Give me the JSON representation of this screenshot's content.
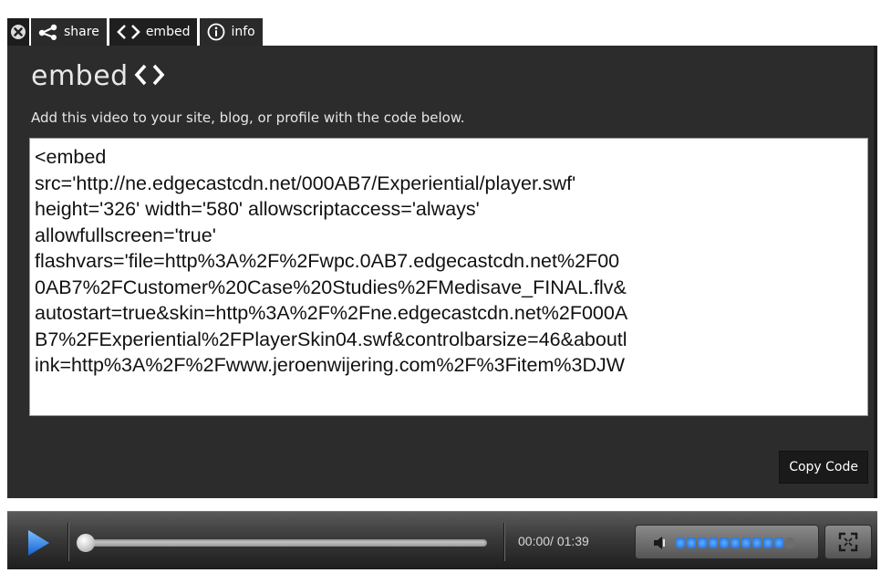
{
  "tabs": [
    {
      "label": "share",
      "icon": "share-icon"
    },
    {
      "label": "embed",
      "icon": "code-brackets-icon"
    },
    {
      "label": "info",
      "icon": "info-icon"
    }
  ],
  "panel": {
    "title": "embed",
    "subtitle": "Add this video to your site, blog, or profile with the code below.",
    "code_lines": [
      "<embed",
      "src='http://ne.edgecastcdn.net/000AB7/Experiential/player.swf'",
      "height='326' width='580' allowscriptaccess='always'",
      "allowfullscreen='true'",
      "flashvars='file=http%3A%2F%2Fwpc.0AB7.edgecastcdn.net%2F00",
      "0AB7%2FCustomer%20Case%20Studies%2FMedisave_FINAL.flv&",
      "autostart=true&skin=http%3A%2F%2Fne.edgecastcdn.net%2F000A",
      "B7%2FExperiential%2FPlayerSkin04.swf&controlbarsize=46&aboutl",
      "ink=http%3A%2F%2Fwww.jeroenwijering.com%2F%3Fitem%3DJW"
    ],
    "copy_button": "Copy Code"
  },
  "controls": {
    "time": "00:00/ 01:39",
    "progress": 0.0,
    "volume_segments_on": 10,
    "volume_segments_total": 11
  },
  "colors": {
    "panel_bg": "#2c2c2c",
    "accent_blue": "#2a7fe8"
  }
}
